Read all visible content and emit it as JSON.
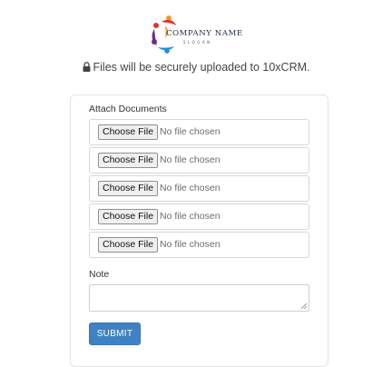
{
  "header": {
    "company_name": "COMPANY NAME",
    "slogan": "SLOGAN",
    "notice_text": "Files will be securely uploaded to 10xCRM.",
    "notice_icon": "lock-icon"
  },
  "form": {
    "attach_label": "Attach Documents",
    "file_inputs": [
      {
        "button_label": "Choose File",
        "status": "No file chosen"
      },
      {
        "button_label": "Choose File",
        "status": "No file chosen"
      },
      {
        "button_label": "Choose File",
        "status": "No file chosen"
      },
      {
        "button_label": "Choose File",
        "status": "No file chosen"
      },
      {
        "button_label": "Choose File",
        "status": "No file chosen"
      }
    ],
    "note_label": "Note",
    "note_value": "",
    "submit_label": "SUBMIT"
  },
  "colors": {
    "submit_button": "#3f82c4",
    "logo_red": "#e2342f",
    "logo_purple": "#6a2c91",
    "logo_blue": "#1f8fd6",
    "logo_orange": "#f39a1e"
  }
}
